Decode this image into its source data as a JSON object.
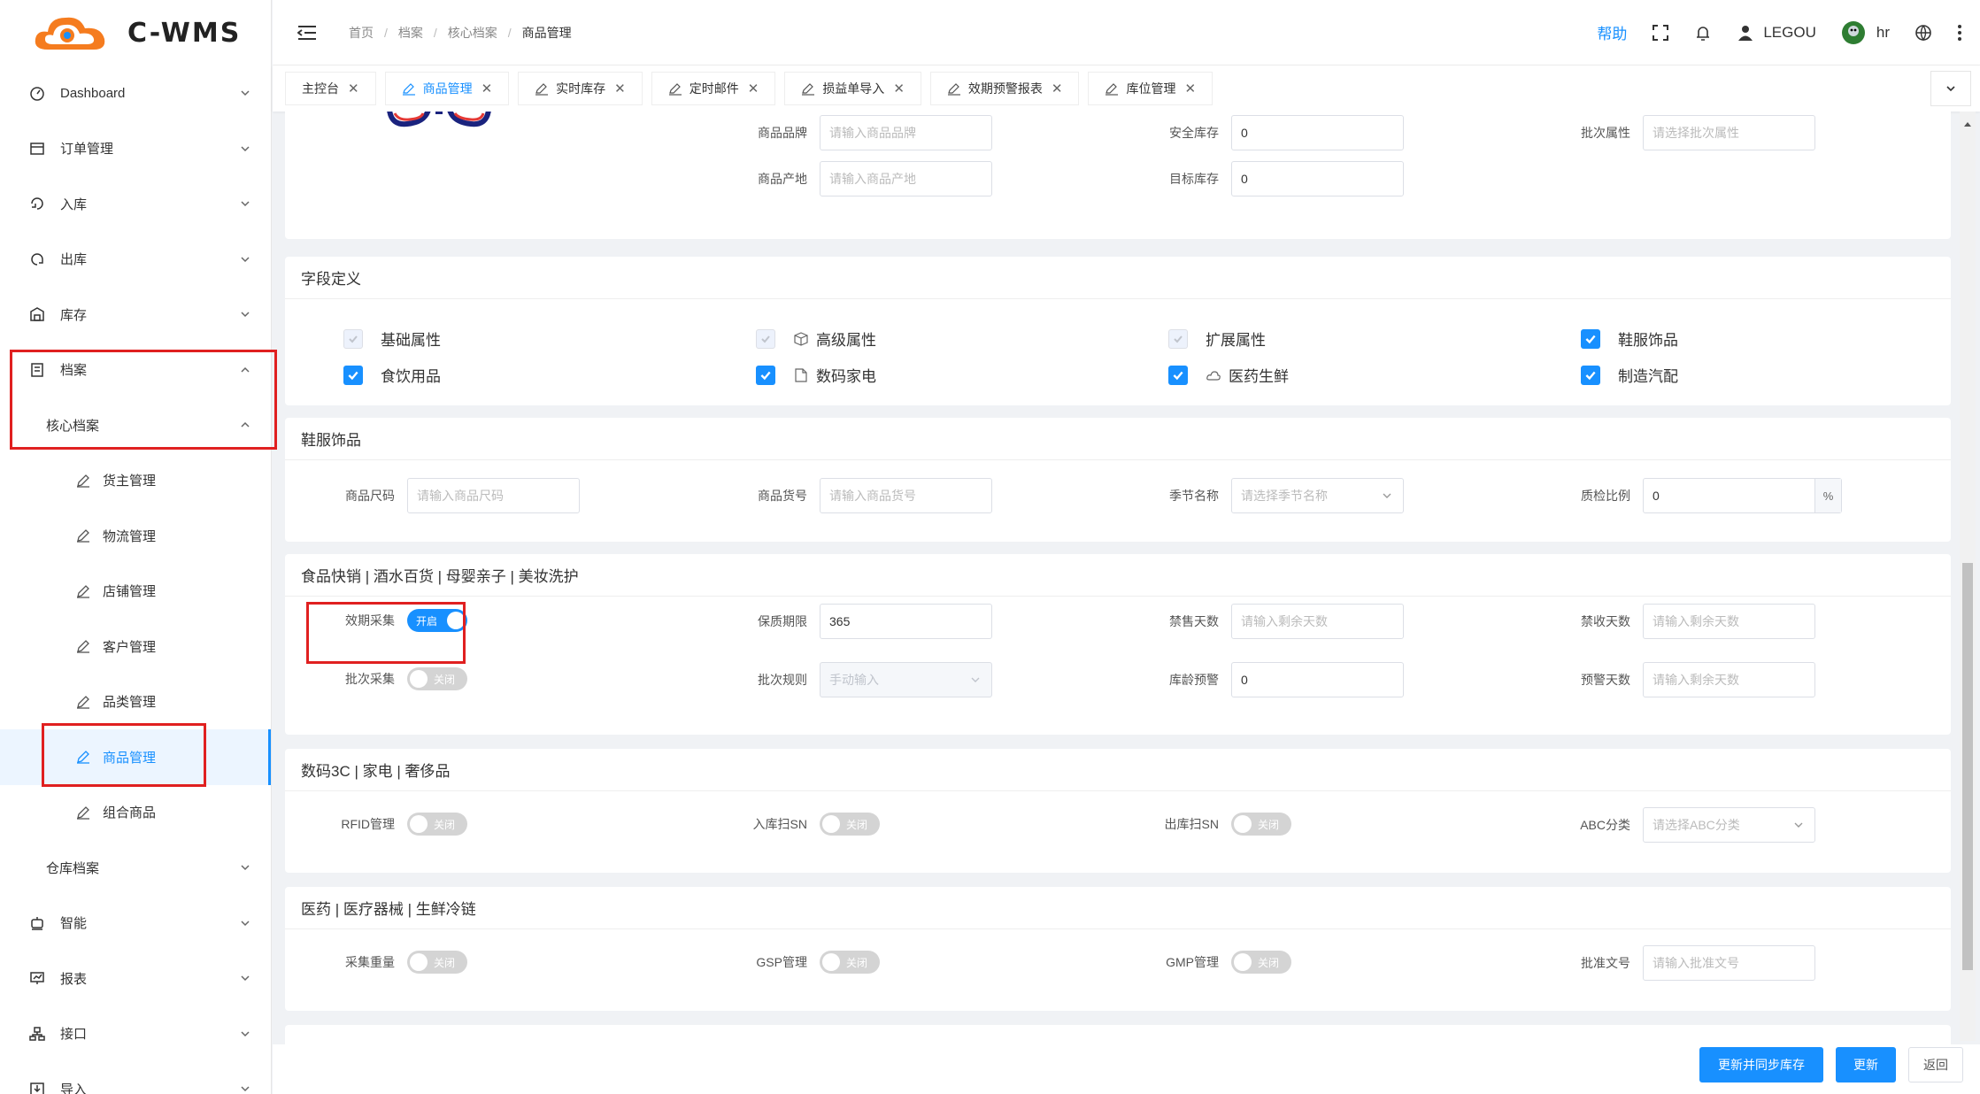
{
  "brand": {
    "name": "C-WMS"
  },
  "sidebar": {
    "items": [
      {
        "label": "Dashboard",
        "icon": "dashboard-icon"
      },
      {
        "label": "订单管理",
        "icon": "order-icon"
      },
      {
        "label": "入库",
        "icon": "inbound-icon"
      },
      {
        "label": "出库",
        "icon": "outbound-icon"
      },
      {
        "label": "库存",
        "icon": "inventory-icon"
      },
      {
        "label": "档案",
        "icon": "archive-icon"
      },
      {
        "label": "核心档案"
      },
      {
        "label": "货主管理"
      },
      {
        "label": "物流管理"
      },
      {
        "label": "店铺管理"
      },
      {
        "label": "客户管理"
      },
      {
        "label": "品类管理"
      },
      {
        "label": "商品管理"
      },
      {
        "label": "组合商品"
      },
      {
        "label": "仓库档案"
      },
      {
        "label": "智能",
        "icon": "smart-icon"
      },
      {
        "label": "报表",
        "icon": "report-icon"
      },
      {
        "label": "接口",
        "icon": "interface-icon"
      },
      {
        "label": "导入",
        "icon": "import-icon"
      }
    ]
  },
  "header": {
    "breadcrumb": [
      "首页",
      "档案",
      "核心档案",
      "商品管理"
    ],
    "help": "帮助",
    "user": "LEGOU",
    "role": "hr"
  },
  "tabs": [
    {
      "label": "主控台"
    },
    {
      "label": "商品管理"
    },
    {
      "label": "实时库存"
    },
    {
      "label": "定时邮件"
    },
    {
      "label": "损益单导入"
    },
    {
      "label": "效期预警报表"
    },
    {
      "label": "库位管理"
    }
  ],
  "top_section": {
    "fields": [
      {
        "label": "商品品牌",
        "placeholder": "请输入商品品牌"
      },
      {
        "label": "安全库存",
        "value": "0"
      },
      {
        "label": "批次属性",
        "placeholder": "请选择批次属性"
      },
      {
        "label": "商品产地",
        "placeholder": "请输入商品产地"
      },
      {
        "label": "目标库存",
        "value": "0"
      }
    ]
  },
  "field_def": {
    "title": "字段定义",
    "items": [
      {
        "label": "基础属性",
        "state": "disabled"
      },
      {
        "label": "高级属性",
        "state": "disabled"
      },
      {
        "label": "扩展属性",
        "state": "disabled"
      },
      {
        "label": "鞋服饰品",
        "state": "checked"
      },
      {
        "label": "食饮用品",
        "state": "checked"
      },
      {
        "label": "数码家电",
        "state": "checked"
      },
      {
        "label": "医药生鲜",
        "state": "checked"
      },
      {
        "label": "制造汽配",
        "state": "checked"
      }
    ]
  },
  "apparel": {
    "title": "鞋服饰品",
    "size_label": "商品尺码",
    "size_ph": "请输入商品尺码",
    "sku_label": "商品货号",
    "sku_ph": "请输入商品货号",
    "season_label": "季节名称",
    "season_ph": "请选择季节名称",
    "qc_label": "质检比例",
    "qc_value": "0",
    "qc_suffix": "%"
  },
  "food": {
    "title": "食品快销 | 酒水百货 | 母婴亲子 | 美妆洗护",
    "expiry_label": "效期采集",
    "expiry_switch": "开启",
    "shelf_label": "保质期限",
    "shelf_value": "365",
    "nosale_label": "禁售天数",
    "nosale_ph": "请输入剩余天数",
    "noreceive_label": "禁收天数",
    "noreceive_ph": "请输入剩余天数",
    "batch_label": "批次采集",
    "batch_switch": "关闭",
    "rule_label": "批次规则",
    "rule_ph": "手动输入",
    "age_label": "库龄预警",
    "age_value": "0",
    "warn_label": "预警天数",
    "warn_ph": "请输入剩余天数"
  },
  "digital": {
    "title": "数码3C | 家电 | 奢侈品",
    "rfid_label": "RFID管理",
    "rfid_switch": "关闭",
    "insn_label": "入库扫SN",
    "insn_switch": "关闭",
    "outsn_label": "出库扫SN",
    "outsn_switch": "关闭",
    "abc_label": "ABC分类",
    "abc_ph": "请选择ABC分类"
  },
  "medical": {
    "title": "医药 | 医疗器械 | 生鲜冷链",
    "weight_label": "采集重量",
    "weight_switch": "关闭",
    "gsp_label": "GSP管理",
    "gsp_switch": "关闭",
    "gmp_label": "GMP管理",
    "gmp_switch": "关闭",
    "approval_label": "批准文号",
    "approval_ph": "请输入批准文号"
  },
  "footer": {
    "sync_update": "更新并同步库存",
    "update": "更新",
    "back": "返回"
  },
  "colors": {
    "primary": "#1890ff",
    "highlight": "#e02020"
  }
}
